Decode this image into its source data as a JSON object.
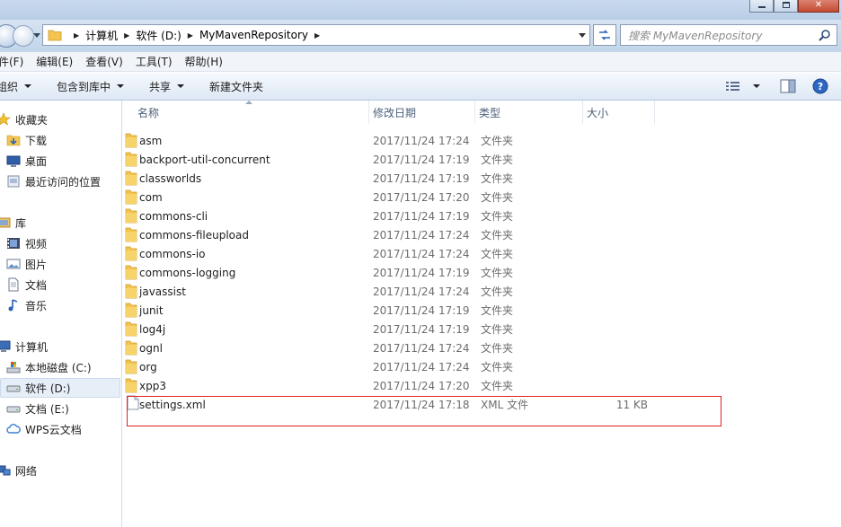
{
  "address": {
    "crumbs": [
      "计算机",
      "软件 (D:)",
      "MyMavenRepository"
    ],
    "search_placeholder": "搜索 MyMavenRepository"
  },
  "menubar": [
    "件(F)",
    "编辑(E)",
    "查看(V)",
    "工具(T)",
    "帮助(H)"
  ],
  "commands": {
    "organize": "组织",
    "include": "包含到库中",
    "share": "共享",
    "new_folder": "新建文件夹"
  },
  "sidebar": {
    "favorites": "收藏夹",
    "downloads": "下载",
    "desktop": "桌面",
    "recent": "最近访问的位置",
    "libraries": "库",
    "videos": "视频",
    "pictures": "图片",
    "documents": "文档",
    "music": "音乐",
    "computer": "计算机",
    "drive_c": "本地磁盘 (C:)",
    "drive_d": "软件 (D:)",
    "drive_e": "文档 (E:)",
    "wps": "WPS云文档",
    "network": "网络"
  },
  "columns": {
    "name": "名称",
    "date": "修改日期",
    "type": "类型",
    "size": "大小"
  },
  "files": [
    {
      "name": "asm",
      "date": "2017/11/24 17:24",
      "type": "文件夹",
      "size": ""
    },
    {
      "name": "backport-util-concurrent",
      "date": "2017/11/24 17:19",
      "type": "文件夹",
      "size": ""
    },
    {
      "name": "classworlds",
      "date": "2017/11/24 17:19",
      "type": "文件夹",
      "size": ""
    },
    {
      "name": "com",
      "date": "2017/11/24 17:20",
      "type": "文件夹",
      "size": ""
    },
    {
      "name": "commons-cli",
      "date": "2017/11/24 17:19",
      "type": "文件夹",
      "size": ""
    },
    {
      "name": "commons-fileupload",
      "date": "2017/11/24 17:24",
      "type": "文件夹",
      "size": ""
    },
    {
      "name": "commons-io",
      "date": "2017/11/24 17:24",
      "type": "文件夹",
      "size": ""
    },
    {
      "name": "commons-logging",
      "date": "2017/11/24 17:19",
      "type": "文件夹",
      "size": ""
    },
    {
      "name": "javassist",
      "date": "2017/11/24 17:24",
      "type": "文件夹",
      "size": ""
    },
    {
      "name": "junit",
      "date": "2017/11/24 17:19",
      "type": "文件夹",
      "size": ""
    },
    {
      "name": "log4j",
      "date": "2017/11/24 17:19",
      "type": "文件夹",
      "size": ""
    },
    {
      "name": "ognl",
      "date": "2017/11/24 17:24",
      "type": "文件夹",
      "size": ""
    },
    {
      "name": "org",
      "date": "2017/11/24 17:24",
      "type": "文件夹",
      "size": ""
    },
    {
      "name": "xpp3",
      "date": "2017/11/24 17:20",
      "type": "文件夹",
      "size": ""
    },
    {
      "name": "settings.xml",
      "date": "2017/11/24 17:18",
      "type": "XML 文件",
      "size": "11 KB"
    }
  ],
  "colors": {
    "highlight": "#e02020",
    "folder": "#f4c44e",
    "selection": "#e6eef8"
  }
}
